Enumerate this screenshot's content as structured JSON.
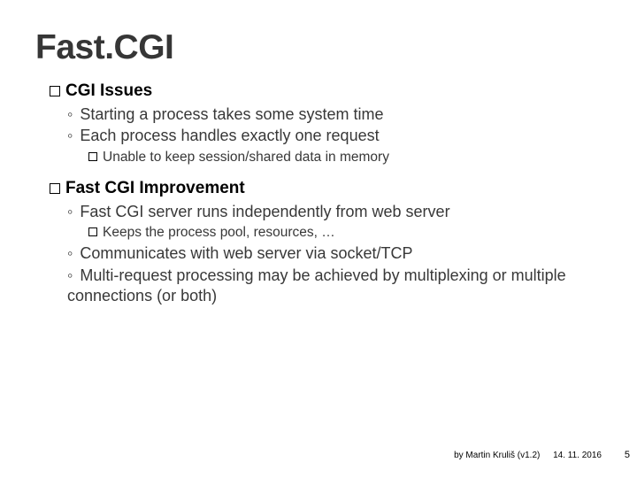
{
  "title": "Fast.CGI",
  "section1": {
    "header": "CGI Issues",
    "items": [
      "Starting a process takes some system time",
      "Each process handles exactly one request"
    ],
    "subitems": [
      "Unable to keep session/shared data in memory"
    ]
  },
  "section2": {
    "header": "Fast CGI Improvement",
    "item1": "Fast CGI server runs independently from web server",
    "subitem1": "Keeps the process pool, resources, …",
    "item2": "Communicates with web server via socket/TCP",
    "item3": "Multi-request processing may be achieved by multiplexing or multiple connections (or both)"
  },
  "footer": {
    "author": "by Martin Kruliš (v1.2)",
    "date": "14. 11. 2016",
    "page": "5"
  }
}
